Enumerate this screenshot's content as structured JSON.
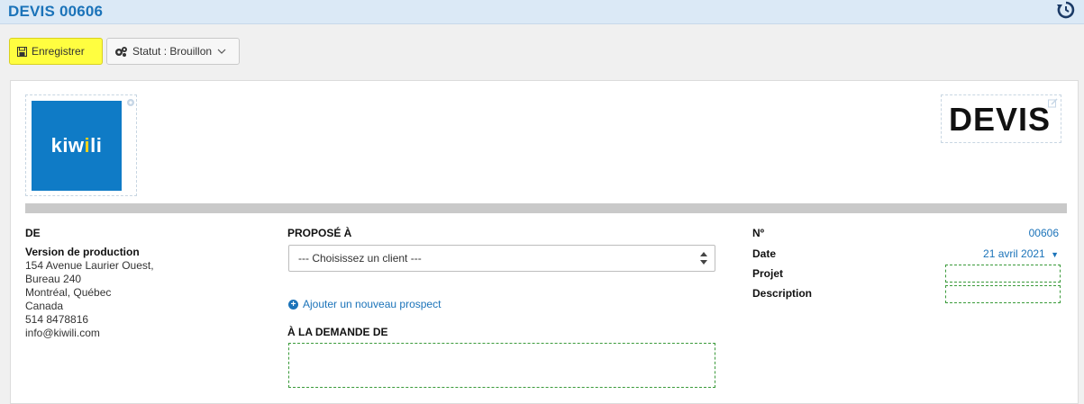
{
  "header": {
    "title": "DEVIS 00606",
    "history_icon": "history-icon"
  },
  "toolbar": {
    "save_label": "Enregistrer",
    "save_icon": "floppy-disk-icon",
    "status_label": "Statut : Brouillon",
    "status_icon": "cogs-icon",
    "status_caret": "chevron-down-icon"
  },
  "document": {
    "logo_text_main": "kiw",
    "logo_text_dot": "i",
    "logo_text_end": "li",
    "doc_type": "DEVIS",
    "from": {
      "heading": "DE",
      "company": "Version de production",
      "address_lines": [
        "154 Avenue Laurier Ouest,",
        "Bureau 240",
        "Montréal, Québec",
        "Canada",
        "514 8478816",
        "info@kiwili.com"
      ]
    },
    "to": {
      "heading": "PROPOSÉ À",
      "client_select_placeholder": "--- Choisissez un client ---",
      "add_prospect_label": "Ajouter un nouveau prospect",
      "requested_by_heading": "À LA DEMANDE DE"
    },
    "meta": {
      "number_label": "Nº",
      "number_value": "00606",
      "date_label": "Date",
      "date_value": "21 avril 2021",
      "project_label": "Projet",
      "description_label": "Description"
    }
  },
  "colors": {
    "accent": "#1b73b9",
    "highlight": "#fffe40",
    "logo_bg": "#0f7bc6",
    "topbar_bg": "#dbe9f6"
  }
}
